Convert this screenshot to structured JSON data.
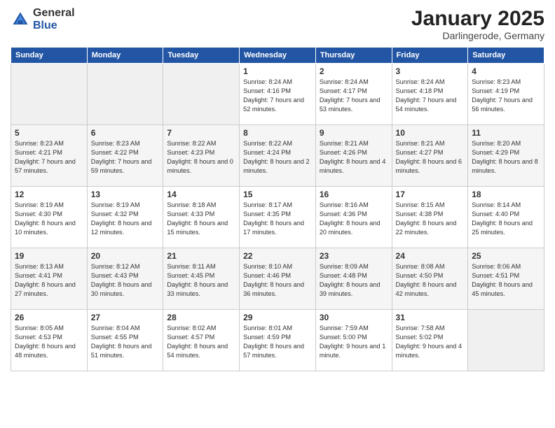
{
  "logo": {
    "general": "General",
    "blue": "Blue"
  },
  "title": "January 2025",
  "subtitle": "Darlingerode, Germany",
  "days_of_week": [
    "Sunday",
    "Monday",
    "Tuesday",
    "Wednesday",
    "Thursday",
    "Friday",
    "Saturday"
  ],
  "weeks": [
    [
      {
        "day": "",
        "info": ""
      },
      {
        "day": "",
        "info": ""
      },
      {
        "day": "",
        "info": ""
      },
      {
        "day": "1",
        "info": "Sunrise: 8:24 AM\nSunset: 4:16 PM\nDaylight: 7 hours and 52 minutes."
      },
      {
        "day": "2",
        "info": "Sunrise: 8:24 AM\nSunset: 4:17 PM\nDaylight: 7 hours and 53 minutes."
      },
      {
        "day": "3",
        "info": "Sunrise: 8:24 AM\nSunset: 4:18 PM\nDaylight: 7 hours and 54 minutes."
      },
      {
        "day": "4",
        "info": "Sunrise: 8:23 AM\nSunset: 4:19 PM\nDaylight: 7 hours and 56 minutes."
      }
    ],
    [
      {
        "day": "5",
        "info": "Sunrise: 8:23 AM\nSunset: 4:21 PM\nDaylight: 7 hours and 57 minutes."
      },
      {
        "day": "6",
        "info": "Sunrise: 8:23 AM\nSunset: 4:22 PM\nDaylight: 7 hours and 59 minutes."
      },
      {
        "day": "7",
        "info": "Sunrise: 8:22 AM\nSunset: 4:23 PM\nDaylight: 8 hours and 0 minutes."
      },
      {
        "day": "8",
        "info": "Sunrise: 8:22 AM\nSunset: 4:24 PM\nDaylight: 8 hours and 2 minutes."
      },
      {
        "day": "9",
        "info": "Sunrise: 8:21 AM\nSunset: 4:26 PM\nDaylight: 8 hours and 4 minutes."
      },
      {
        "day": "10",
        "info": "Sunrise: 8:21 AM\nSunset: 4:27 PM\nDaylight: 8 hours and 6 minutes."
      },
      {
        "day": "11",
        "info": "Sunrise: 8:20 AM\nSunset: 4:29 PM\nDaylight: 8 hours and 8 minutes."
      }
    ],
    [
      {
        "day": "12",
        "info": "Sunrise: 8:19 AM\nSunset: 4:30 PM\nDaylight: 8 hours and 10 minutes."
      },
      {
        "day": "13",
        "info": "Sunrise: 8:19 AM\nSunset: 4:32 PM\nDaylight: 8 hours and 12 minutes."
      },
      {
        "day": "14",
        "info": "Sunrise: 8:18 AM\nSunset: 4:33 PM\nDaylight: 8 hours and 15 minutes."
      },
      {
        "day": "15",
        "info": "Sunrise: 8:17 AM\nSunset: 4:35 PM\nDaylight: 8 hours and 17 minutes."
      },
      {
        "day": "16",
        "info": "Sunrise: 8:16 AM\nSunset: 4:36 PM\nDaylight: 8 hours and 20 minutes."
      },
      {
        "day": "17",
        "info": "Sunrise: 8:15 AM\nSunset: 4:38 PM\nDaylight: 8 hours and 22 minutes."
      },
      {
        "day": "18",
        "info": "Sunrise: 8:14 AM\nSunset: 4:40 PM\nDaylight: 8 hours and 25 minutes."
      }
    ],
    [
      {
        "day": "19",
        "info": "Sunrise: 8:13 AM\nSunset: 4:41 PM\nDaylight: 8 hours and 27 minutes."
      },
      {
        "day": "20",
        "info": "Sunrise: 8:12 AM\nSunset: 4:43 PM\nDaylight: 8 hours and 30 minutes."
      },
      {
        "day": "21",
        "info": "Sunrise: 8:11 AM\nSunset: 4:45 PM\nDaylight: 8 hours and 33 minutes."
      },
      {
        "day": "22",
        "info": "Sunrise: 8:10 AM\nSunset: 4:46 PM\nDaylight: 8 hours and 36 minutes."
      },
      {
        "day": "23",
        "info": "Sunrise: 8:09 AM\nSunset: 4:48 PM\nDaylight: 8 hours and 39 minutes."
      },
      {
        "day": "24",
        "info": "Sunrise: 8:08 AM\nSunset: 4:50 PM\nDaylight: 8 hours and 42 minutes."
      },
      {
        "day": "25",
        "info": "Sunrise: 8:06 AM\nSunset: 4:51 PM\nDaylight: 8 hours and 45 minutes."
      }
    ],
    [
      {
        "day": "26",
        "info": "Sunrise: 8:05 AM\nSunset: 4:53 PM\nDaylight: 8 hours and 48 minutes."
      },
      {
        "day": "27",
        "info": "Sunrise: 8:04 AM\nSunset: 4:55 PM\nDaylight: 8 hours and 51 minutes."
      },
      {
        "day": "28",
        "info": "Sunrise: 8:02 AM\nSunset: 4:57 PM\nDaylight: 8 hours and 54 minutes."
      },
      {
        "day": "29",
        "info": "Sunrise: 8:01 AM\nSunset: 4:59 PM\nDaylight: 8 hours and 57 minutes."
      },
      {
        "day": "30",
        "info": "Sunrise: 7:59 AM\nSunset: 5:00 PM\nDaylight: 9 hours and 1 minute."
      },
      {
        "day": "31",
        "info": "Sunrise: 7:58 AM\nSunset: 5:02 PM\nDaylight: 9 hours and 4 minutes."
      },
      {
        "day": "",
        "info": ""
      }
    ]
  ]
}
